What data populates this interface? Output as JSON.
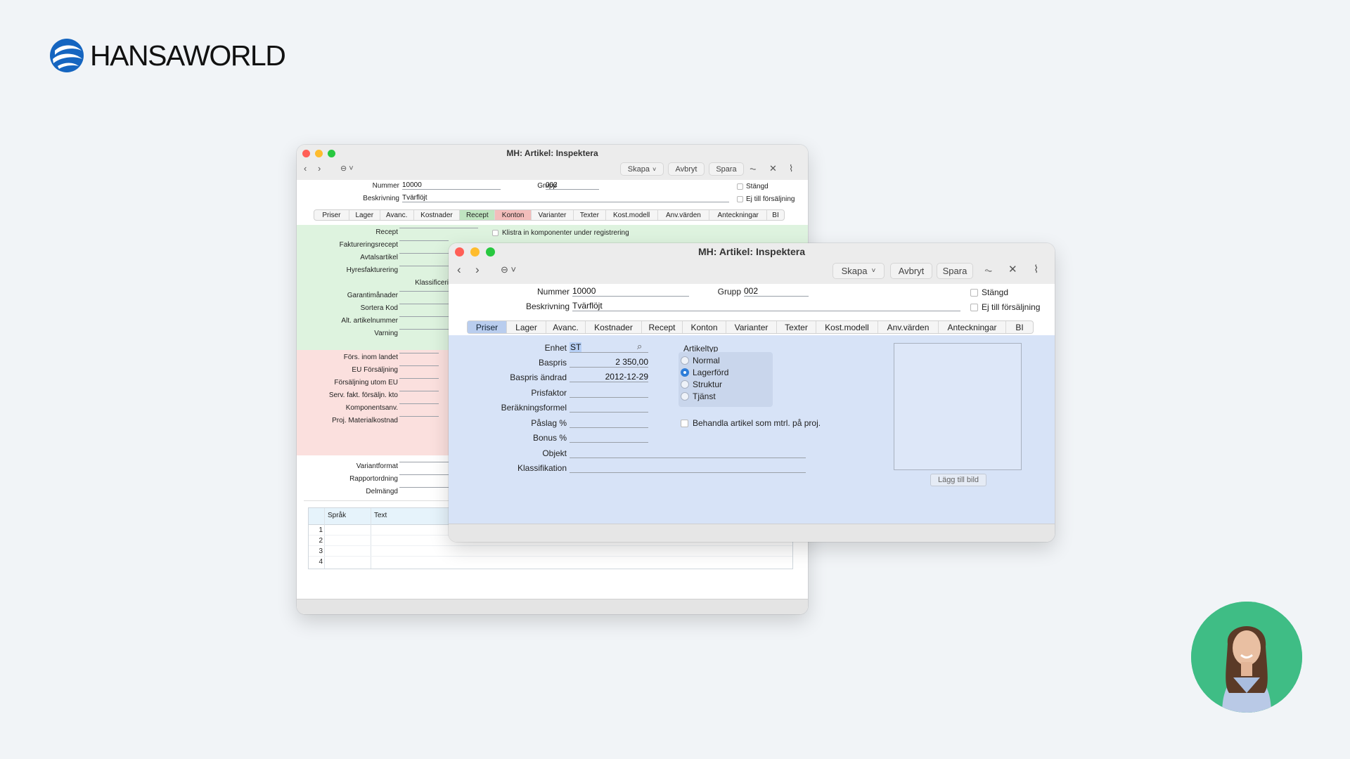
{
  "brand": {
    "name": "HANSAWORLD",
    "logo_icon": "hansaworld-globe-icon"
  },
  "back_window": {
    "title": "MH: Artikel: Inspektera",
    "toolbar": {
      "create": "Skapa",
      "cancel": "Avbryt",
      "save": "Spara"
    },
    "header": {
      "number_label": "Nummer",
      "number_value": "10000",
      "group_label": "Grupp",
      "group_value": "002",
      "description_label": "Beskrivning",
      "description_value": "Tvärflöjt",
      "closed_label": "Stängd",
      "not_for_sale_label": "Ej till försäljning"
    },
    "tabs": [
      "Priser",
      "Lager",
      "Avanc.",
      "Kostnader",
      "Recept",
      "Konton",
      "Varianter",
      "Texter",
      "Kost.modell",
      "Anv.värden",
      "Anteckningar",
      "BI"
    ],
    "green_section": {
      "labels": [
        "Recept",
        "Faktureringsrecept",
        "Avtalsartikel",
        "Hyresfakturering",
        "Klassificeri",
        "Garantimånader",
        "Sortera Kod",
        "Alt. artikelnummer",
        "Varning"
      ],
      "paste_components": "Klistra in komponenter under registrering"
    },
    "red_section": {
      "labels": [
        "Förs. inom landet",
        "EU Försäljning",
        "Försäljning utom EU",
        "Serv. fakt. försälјn. kto",
        "Komponentsanv.",
        "Proj. Materialkostnad"
      ]
    },
    "white_section": {
      "labels": [
        "Variantformat",
        "Rapportordning",
        "Delmängd"
      ]
    },
    "grid": {
      "col_language": "Språk",
      "col_text": "Text",
      "rows": [
        "1",
        "2",
        "3",
        "4"
      ]
    }
  },
  "front_window": {
    "title": "MH: Artikel: Inspektera",
    "toolbar": {
      "create": "Skapa",
      "cancel": "Avbryt",
      "save": "Spara"
    },
    "header": {
      "number_label": "Nummer",
      "number_value": "10000",
      "group_label": "Grupp",
      "group_value": "002",
      "description_label": "Beskrivning",
      "description_value": "Tvärflöjt",
      "closed_label": "Stängd",
      "not_for_sale_label": "Ej till försäljning"
    },
    "tabs": [
      "Priser",
      "Lager",
      "Avanc.",
      "Kostnader",
      "Recept",
      "Konton",
      "Varianter",
      "Texter",
      "Kost.modell",
      "Anv.värden",
      "Anteckningar",
      "BI"
    ],
    "active_tab": "Priser",
    "prices": {
      "unit_label": "Enhet",
      "unit_value": "ST",
      "base_price_label": "Baspris",
      "base_price_value": "2 350,00",
      "base_price_changed_label": "Baspris ändrad",
      "base_price_changed_value": "2012-12-29",
      "price_factor_label": "Prisfaktor",
      "calc_formula_label": "Beräkningsformel",
      "markup_label": "Påslag %",
      "bonus_label": "Bonus %",
      "object_label": "Objekt",
      "classification_label": "Klassifikation"
    },
    "item_type": {
      "label": "Artikeltyp",
      "options": [
        "Normal",
        "Lagerförd",
        "Struktur",
        "Tjänst"
      ],
      "selected": "Lagerförd"
    },
    "treat_as_material": "Behandla artikel som mtrl. på proj.",
    "add_image": "Lägg till bild"
  },
  "colors": {
    "background": "#f1f4f7",
    "prices_panel": "#d7e3f7",
    "green_panel": "#def3df",
    "red_panel": "#fbe0de",
    "radio_selected": "#2a7bd8",
    "avatar_bg": "#3fbd85"
  }
}
